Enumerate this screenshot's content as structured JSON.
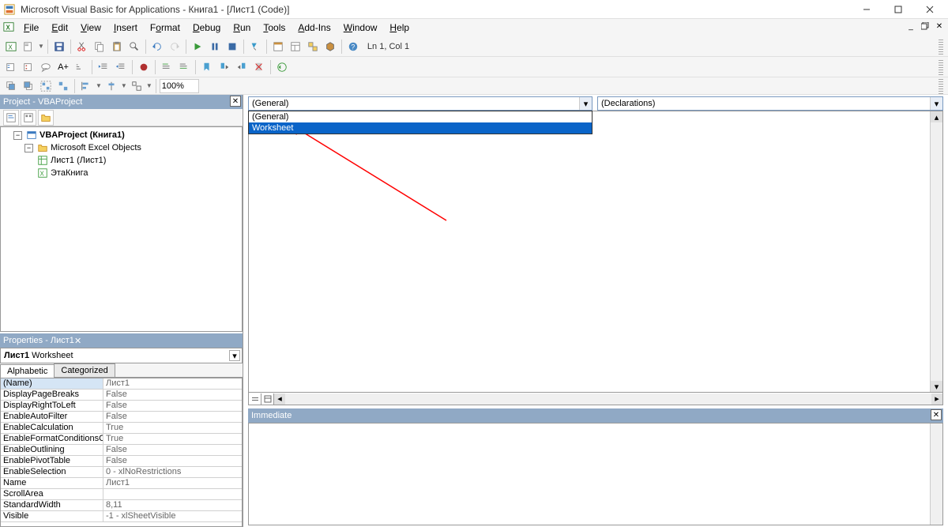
{
  "title": "Microsoft Visual Basic for Applications - Книга1 - [Лист1 (Code)]",
  "menus": [
    "File",
    "Edit",
    "View",
    "Insert",
    "Format",
    "Debug",
    "Run",
    "Tools",
    "Add-Ins",
    "Window",
    "Help"
  ],
  "status": {
    "pos": "Ln 1, Col 1"
  },
  "zoom": "100%",
  "project_pane": {
    "title": "Project - VBAProject",
    "root": "VBAProject (Книга1)",
    "folder": "Microsoft Excel Objects",
    "items": [
      "Лист1 (Лист1)",
      "ЭтаКнига"
    ]
  },
  "properties_pane": {
    "title": "Properties - Лист1",
    "object_name": "Лист1",
    "object_type": "Worksheet",
    "tabs": [
      "Alphabetic",
      "Categorized"
    ],
    "rows": [
      {
        "k": "(Name)",
        "v": "Лист1"
      },
      {
        "k": "DisplayPageBreaks",
        "v": "False"
      },
      {
        "k": "DisplayRightToLeft",
        "v": "False"
      },
      {
        "k": "EnableAutoFilter",
        "v": "False"
      },
      {
        "k": "EnableCalculation",
        "v": "True"
      },
      {
        "k": "EnableFormatConditionsCalculation",
        "v": "True"
      },
      {
        "k": "EnableOutlining",
        "v": "False"
      },
      {
        "k": "EnablePivotTable",
        "v": "False"
      },
      {
        "k": "EnableSelection",
        "v": "0 - xlNoRestrictions"
      },
      {
        "k": "Name",
        "v": "Лист1"
      },
      {
        "k": "ScrollArea",
        "v": ""
      },
      {
        "k": "StandardWidth",
        "v": "8,11"
      },
      {
        "k": "Visible",
        "v": "-1 - xlSheetVisible"
      }
    ]
  },
  "code_area": {
    "object_combo": {
      "value": "(General)",
      "options": [
        "(General)",
        "Worksheet"
      ],
      "selected_index": 1
    },
    "proc_combo": {
      "value": "(Declarations)"
    }
  },
  "immediate": {
    "title": "Immediate"
  }
}
